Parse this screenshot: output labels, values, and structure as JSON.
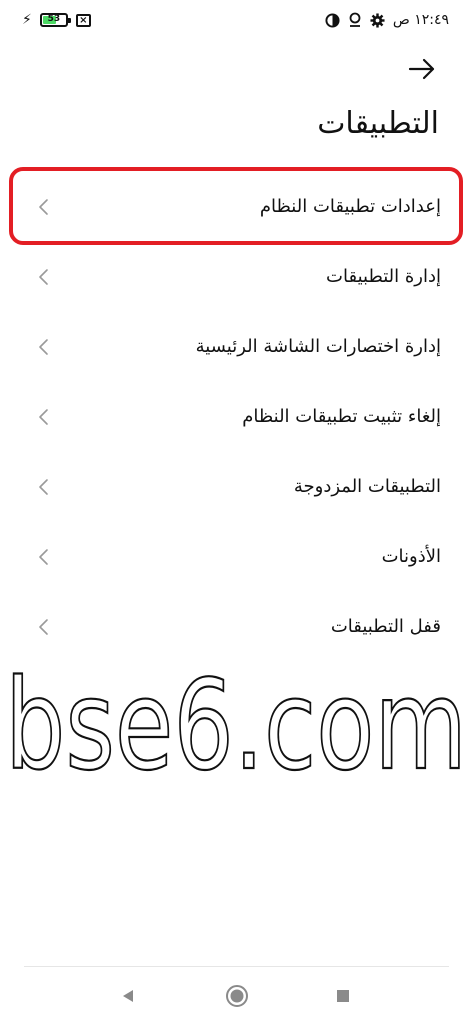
{
  "status_bar": {
    "battery_level": "53",
    "time": "١٢:٤٩ ص",
    "icons": [
      "charging-bolt-icon",
      "battery-icon",
      "no-sim-icon",
      "gear-icon",
      "location-icon",
      "data-saver-icon"
    ]
  },
  "header": {
    "title": "التطبيقات",
    "back_icon": "arrow-right-icon"
  },
  "list": {
    "items": [
      {
        "label": "إعدادات تطبيقات النظام",
        "highlighted": true
      },
      {
        "label": "إدارة التطبيقات"
      },
      {
        "label": "إدارة اختصارات الشاشة الرئيسية"
      },
      {
        "label": "إلغاء تثبيت تطبيقات النظام"
      },
      {
        "label": "التطبيقات المزدوجة"
      },
      {
        "label": "الأذونات"
      },
      {
        "label": "قفل التطبيقات"
      }
    ]
  },
  "watermark": {
    "text": "bse6.com"
  },
  "nav_bar": {
    "buttons": [
      "back-triangle-icon",
      "home-circle-icon",
      "recents-square-icon"
    ]
  },
  "colors": {
    "highlight": "#e31e24",
    "battery_fill": "#4cd964"
  }
}
